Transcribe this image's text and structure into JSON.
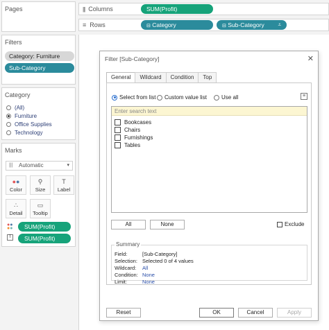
{
  "pages": {
    "title": "Pages"
  },
  "filters": {
    "title": "Filters",
    "items": [
      "Category: Furniture",
      "Sub-Category"
    ]
  },
  "category_card": {
    "title": "Category",
    "options": [
      "(All)",
      "Furniture",
      "Office Supplies",
      "Technology"
    ],
    "selected": "Furniture"
  },
  "marks": {
    "title": "Marks",
    "type": "Automatic",
    "buttons": [
      "Color",
      "Size",
      "Label",
      "Detail",
      "Tooltip"
    ],
    "pills": [
      "SUM(Profit)",
      "SUM(Profit)"
    ]
  },
  "shelves": {
    "columns_label": "Columns",
    "columns_pill": "SUM(Profit)",
    "rows_label": "Rows",
    "rows_pills": [
      "Category",
      "Sub-Category"
    ]
  },
  "dialog": {
    "title": "Filter [Sub-Category]",
    "tabs": [
      "General",
      "Wildcard",
      "Condition",
      "Top"
    ],
    "active_tab": "General",
    "modes": [
      "Select from list",
      "Custom value list",
      "Use all"
    ],
    "selected_mode": "Select from list",
    "search_placeholder": "Enter search text",
    "values": [
      "Bookcases",
      "Chairs",
      "Furnishings",
      "Tables"
    ],
    "all_label": "All",
    "none_label": "None",
    "exclude_label": "Exclude",
    "summary": {
      "title": "Summary",
      "field_label": "Field:",
      "field_value": "[Sub-Category]",
      "selection_label": "Selection:",
      "selection_value": "Selected 0 of 4 values",
      "wildcard_label": "Wildcard:",
      "wildcard_value": "All",
      "condition_label": "Condition:",
      "condition_value": "None",
      "limit_label": "Limit:",
      "limit_value": "None"
    },
    "reset_label": "Reset",
    "ok_label": "OK",
    "cancel_label": "Cancel",
    "apply_label": "Apply"
  },
  "colors": {
    "teal_pill": "#2b8b9c",
    "green_pill": "#16a37a",
    "link_blue": "#2a4ea8"
  }
}
